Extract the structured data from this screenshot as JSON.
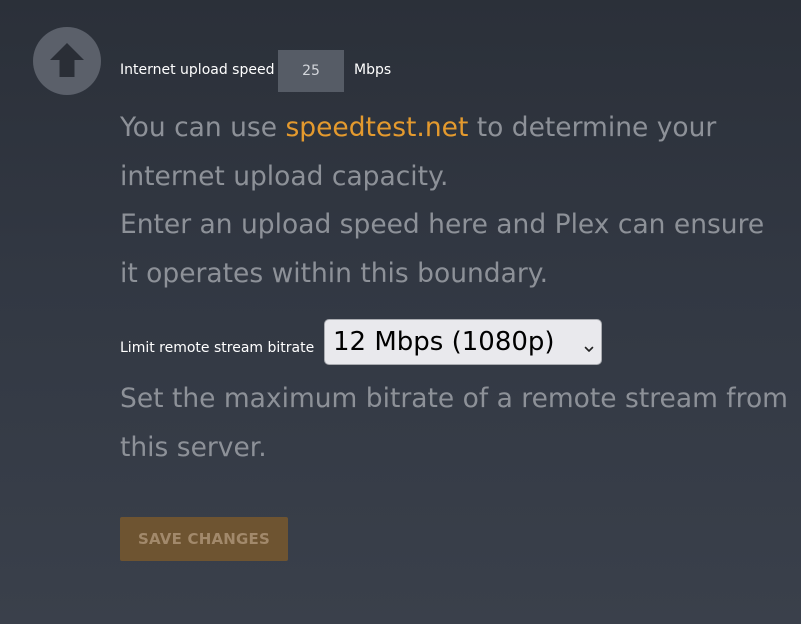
{
  "upload": {
    "label": "Internet upload speed",
    "value": "25",
    "unit": "Mbps",
    "help_before": "You can use ",
    "help_link": "speedtest.net",
    "help_after": " to determine your internet upload capacity.",
    "help_line2": "Enter an upload speed here and Plex can ensure it operates within this boundary."
  },
  "bitrate": {
    "label": "Limit remote stream bitrate",
    "selected": "12 Mbps (1080p)",
    "help": "Set the maximum bitrate of a remote stream from this server."
  },
  "actions": {
    "save_label": "SAVE CHANGES"
  },
  "icons": {
    "upload": "arrow-up-icon",
    "dropdown": "chevron-down-icon"
  },
  "colors": {
    "accent": "#e49a2e",
    "save_button_bg": "#6e5431"
  }
}
